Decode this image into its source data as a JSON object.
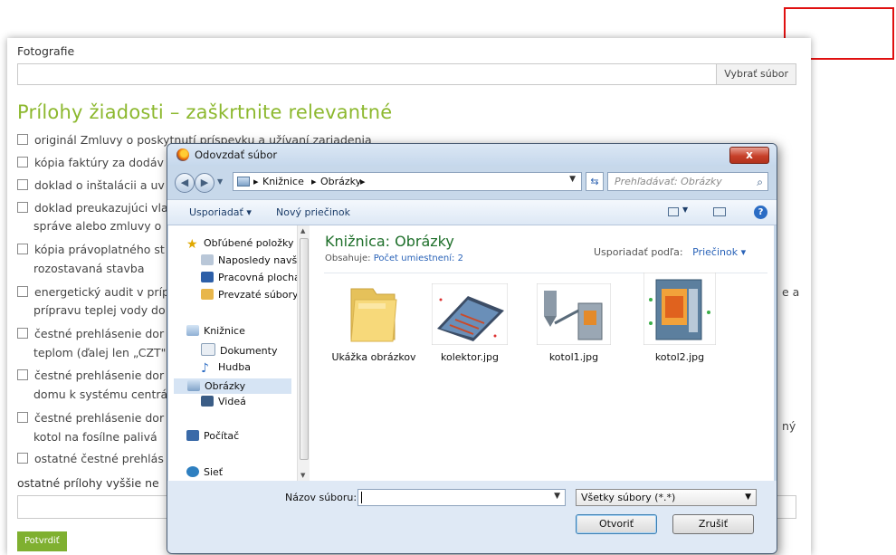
{
  "form": {
    "photo_label": "Fotografie",
    "file_button": "Vybrať súbor",
    "section_title": "Prílohy žiadosti – zaškrtnite relevantné",
    "checkboxes": [
      {
        "line1": "originál Zmluvy o poskytnutí príspevku a užívaní zariadenia"
      },
      {
        "line1": "kópia faktúry za dodáv"
      },
      {
        "line1": "doklad o inštalácii a uv"
      },
      {
        "line1": "doklad preukazujúci vla",
        "line2": "správe alebo zmluvy o"
      },
      {
        "line1": "kópia právoplatného st",
        "line2": "rozostavaná stavba"
      },
      {
        "line1": "energetický audit v príp",
        "line2": "prípravu teplej vody do",
        "right": "e a"
      },
      {
        "line1": "čestné prehlásenie dor",
        "line2": "teplom (ďalej len „CZT\""
      },
      {
        "line1": "čestné prehlásenie dor",
        "line2": "domu k systému centrá"
      },
      {
        "line1": "čestné prehlásenie dor",
        "line2": "kotol na fosílne palivá",
        "right": "ný"
      },
      {
        "line1": "ostatné čestné prehlás"
      }
    ],
    "other_label": "ostatné prílohy vyššie ne",
    "submit": "Potvrdiť"
  },
  "dialog": {
    "title": "Odovzdať súbor",
    "close": "x",
    "breadcrumb": [
      "Knižnice",
      "Obrázky"
    ],
    "search_placeholder": "Prehľadávať: Obrázky",
    "toolbar": {
      "organize": "Usporiadať ▾",
      "new_folder": "Nový priečinok"
    },
    "nav": {
      "favorites": "Obľúbené položky",
      "recent": "Naposledy navšti",
      "desktop": "Pracovná plocha",
      "downloads": "Prevzaté súbory",
      "libraries": "Knižnice",
      "documents": "Dokumenty",
      "music": "Hudba",
      "pictures": "Obrázky",
      "videos": "Videá",
      "computer": "Počítač",
      "network": "Sieť"
    },
    "library_title": "Knižnica: Obrázky",
    "library_includes": "Obsahuje:",
    "library_locations": "Počet umiestnení: 2",
    "arrange_label": "Usporiadať podľa:",
    "arrange_value": "Priečinok ▾",
    "files": [
      {
        "name": "Ukážka obrázkov",
        "icon": "folder-icon"
      },
      {
        "name": "kolektor.jpg",
        "icon": "solar-collector-image"
      },
      {
        "name": "kotol1.jpg",
        "icon": "boiler-system-image"
      },
      {
        "name": "kotol2.jpg",
        "icon": "boiler-cutaway-image"
      }
    ],
    "filename_label": "Názov súboru:",
    "filename_value": "",
    "filetype": "Všetky súbory (*.*)",
    "open": "Otvoriť",
    "cancel": "Zrušiť"
  },
  "colors": {
    "accent_green": "#8cb82e",
    "button_green": "#7fb030",
    "annotation_red": "#e01010",
    "link_blue": "#2a63b8"
  }
}
